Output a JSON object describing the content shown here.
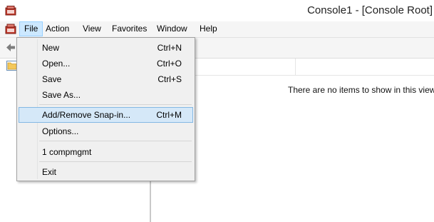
{
  "window": {
    "title": "Console1 - [Console Root]"
  },
  "menubar": {
    "items": [
      {
        "label": "File"
      },
      {
        "label": "Action"
      },
      {
        "label": "View"
      },
      {
        "label": "Favorites"
      },
      {
        "label": "Window"
      },
      {
        "label": "Help"
      }
    ]
  },
  "file_menu": {
    "items": [
      {
        "label": "New",
        "shortcut": "Ctrl+N"
      },
      {
        "label": "Open...",
        "shortcut": "Ctrl+O"
      },
      {
        "label": "Save",
        "shortcut": "Ctrl+S"
      },
      {
        "label": "Save As...",
        "shortcut": ""
      },
      {
        "label": "Add/Remove Snap-in...",
        "shortcut": "Ctrl+M",
        "highlighted": true
      },
      {
        "label": "Options...",
        "shortcut": ""
      },
      {
        "label": "1 compmgmt",
        "shortcut": ""
      },
      {
        "label": "Exit",
        "shortcut": ""
      }
    ]
  },
  "result_pane": {
    "empty_message": "There are no items to show in this view."
  },
  "icons": {
    "app": "mmc-console-icon",
    "menu_app": "mmc-console-icon",
    "back": "back-arrow-icon",
    "tree_root": "folder-icon"
  },
  "colors": {
    "menu_highlight": "#d5e8f8",
    "menu_active": "#cce8ff"
  }
}
